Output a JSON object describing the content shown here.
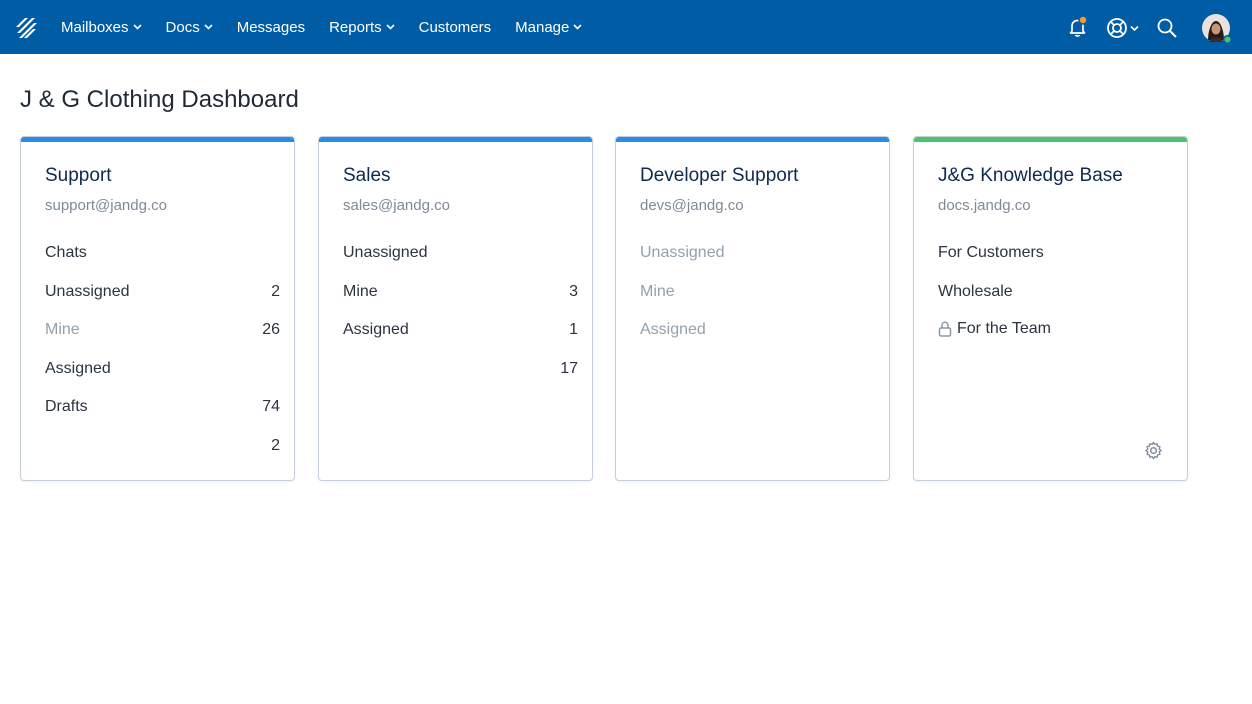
{
  "nav": {
    "logo_icon": "helpscout-logo-icon",
    "items": [
      {
        "label": "Mailboxes",
        "dropdown": true
      },
      {
        "label": "Docs",
        "dropdown": true
      },
      {
        "label": "Messages",
        "dropdown": false
      },
      {
        "label": "Reports",
        "dropdown": true
      },
      {
        "label": "Customers",
        "dropdown": false
      },
      {
        "label": "Manage",
        "dropdown": true
      }
    ],
    "right_icons": [
      "bell-icon",
      "help-lifebuoy-icon",
      "search-icon",
      "avatar"
    ],
    "colors": {
      "bar": "#005ca4",
      "notification_dot": "#f59a2d",
      "online_dot": "#4bc35a"
    }
  },
  "page": {
    "title": "J & G Clothing Dashboard"
  },
  "cards": [
    {
      "title": "Support",
      "subtitle": "support@jandg.co",
      "stripe_color": "#2b8ce6",
      "labels": [
        "Chats",
        "Unassigned",
        "Mine",
        "Assigned",
        "Drafts"
      ],
      "numbers": [
        "2",
        "26",
        "74",
        "2"
      ]
    },
    {
      "title": "Sales",
      "subtitle": "sales@jandg.co",
      "stripe_color": "#2b8ce6",
      "labels": [
        "Unassigned",
        "Mine",
        "Assigned"
      ],
      "numbers": [
        "3",
        "1",
        "17"
      ]
    },
    {
      "title": "Developer Support",
      "subtitle": "devs@jandg.co",
      "stripe_color": "#2b8ce6",
      "labels": [
        "Unassigned",
        "Mine",
        "Assigned"
      ],
      "numbers": []
    },
    {
      "title": "J&G Knowledge Base",
      "subtitle": "docs.jandg.co",
      "stripe_color": "#4bc370",
      "labels": [
        "For Customers",
        "Wholesale",
        "For the Team"
      ],
      "lock_icon": "lock-icon",
      "settings_icon": "gear-icon"
    }
  ]
}
